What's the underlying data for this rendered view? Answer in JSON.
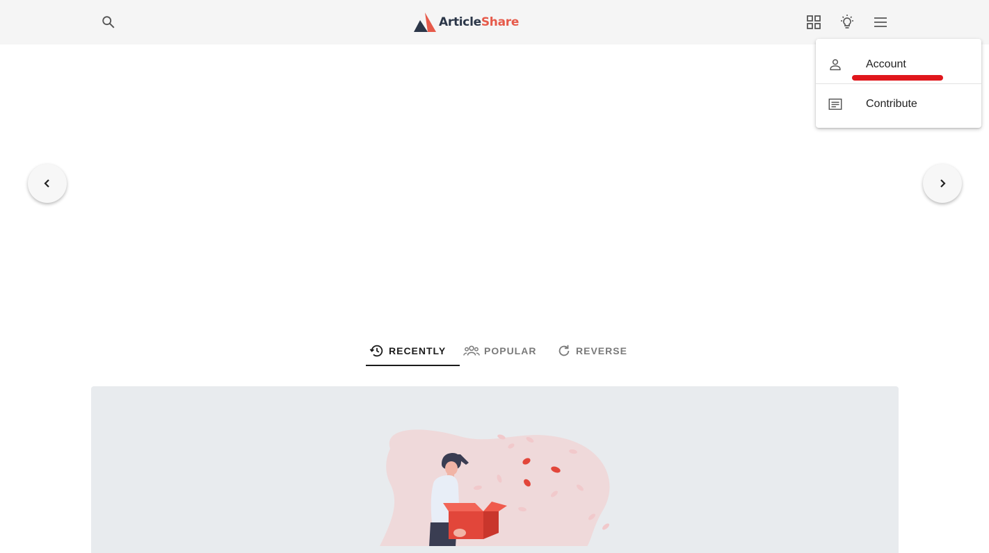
{
  "app": {
    "logo_part1": "Article",
    "logo_part2": "Share"
  },
  "header": {
    "icons": [
      "search-icon",
      "grid-icon",
      "lightbulb-icon",
      "menu-icon"
    ]
  },
  "menu": {
    "items": [
      {
        "label": "Account",
        "icon": "person-icon"
      },
      {
        "label": "Contribute",
        "icon": "article-icon"
      }
    ],
    "highlight_color": "#e0161c"
  },
  "tabs": [
    {
      "label": "RECENTLY",
      "icon": "history-icon",
      "active": true
    },
    {
      "label": "POPULAR",
      "icon": "group-icon",
      "active": false
    },
    {
      "label": "REVERSE",
      "icon": "refresh-icon",
      "active": false
    }
  ],
  "colors": {
    "topbar": "#f5f5f5",
    "brand_dark": "#2b3648",
    "brand_accent": "#e65a4a",
    "panel_bg": "#e8ebee"
  }
}
